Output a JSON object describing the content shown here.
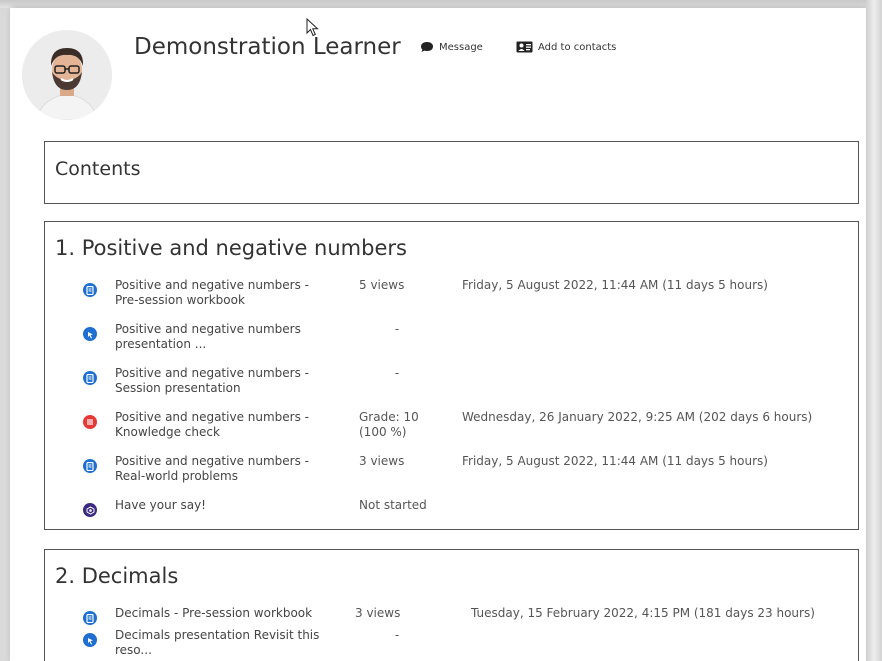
{
  "header": {
    "user_name": "Demonstration Learner",
    "message_label": "Message",
    "add_contacts_label": "Add to contacts"
  },
  "contents": {
    "title": "Contents"
  },
  "sections": [
    {
      "title": "1. Positive and negative numbers",
      "items": [
        {
          "icon": "page-icon",
          "name": "Positive and negative numbers - Pre-session workbook",
          "stat": "5 views",
          "last": "Friday, 5 August 2022, 11:44 AM (11 days 5 hours)"
        },
        {
          "icon": "url-icon",
          "name": "Positive and negative numbers presentation ...",
          "stat": "-",
          "last": ""
        },
        {
          "icon": "page-icon",
          "name": "Positive and negative numbers - Session presentation",
          "stat": "-",
          "last": ""
        },
        {
          "icon": "quiz-icon",
          "name": "Positive and negative numbers - Knowledge check",
          "stat": "Grade: 10 (100 %)",
          "last": "Wednesday, 26 January 2022, 9:25 AM (202 days 6 hours)"
        },
        {
          "icon": "page-icon",
          "name": "Positive and negative numbers - Real-world problems",
          "stat": "3 views",
          "last": "Friday, 5 August 2022, 11:44 AM (11 days 5 hours)"
        },
        {
          "icon": "feedback-icon",
          "name": "Have your say!",
          "stat": "Not started",
          "last": ""
        }
      ]
    },
    {
      "title": "2. Decimals",
      "items": [
        {
          "icon": "page-icon",
          "name": "Decimals - Pre-session workbook",
          "stat": "3 views",
          "last": "Tuesday, 15 February 2022, 4:15 PM (181 days 23 hours)"
        },
        {
          "icon": "url-icon",
          "name": "Decimals presentation Revisit this reso...",
          "stat": "-",
          "last": ""
        }
      ]
    }
  ],
  "colors": {
    "blue_icon": "#1f6fd0",
    "red_icon": "#e53935",
    "purple_icon": "#3b2a82"
  }
}
